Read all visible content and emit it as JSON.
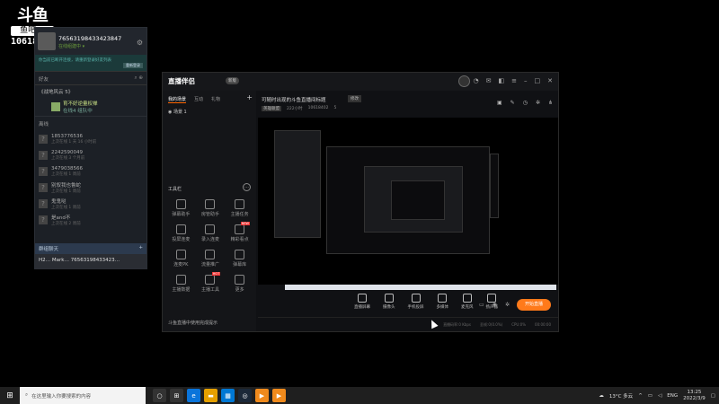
{
  "watermark": {
    "logo": "斗鱼",
    "sub": "鱼吧 ▷",
    "room_id": "10618402"
  },
  "friends": {
    "username": "76563198433423847",
    "status": "在线组建中 ▾",
    "notice": "你当前已断开连接，请重新登录好友列表",
    "notice_button": "重新登录",
    "bar_label": "好友",
    "group_label": "《战地风云 5》",
    "game_name": "育不好逆量权禅",
    "game_sub": "在线4 组队中",
    "section_label": "离线",
    "items": [
      {
        "name": "1853776536",
        "status": "上次在线 1 天 16 小时前"
      },
      {
        "name": "2242590049",
        "status": "上次在线 3 个月前"
      },
      {
        "name": "3479038566",
        "status": "上次在线 1 周前"
      },
      {
        "name": "别叙我也鲁蛇",
        "status": "上次在线 1 周前"
      },
      {
        "name": "鬼鬼哒",
        "status": "上次在线 1 周前"
      },
      {
        "name": "是and不",
        "status": "上次在线 2 周前"
      }
    ],
    "chatbar": "群组聊天",
    "chattab": "H2… Mark… 76563198433423…"
  },
  "app": {
    "brand": "直播伴侣",
    "version": "新版",
    "tabs": [
      "我的场景",
      "互动",
      "礼物"
    ],
    "scene": "场景 1",
    "tools_header": "工具栏",
    "tools": [
      {
        "label": "弹幕助手",
        "badge": ""
      },
      {
        "label": "房管助手",
        "badge": ""
      },
      {
        "label": "主播任务",
        "badge": ""
      },
      {
        "label": "投屏连麦",
        "badge": ""
      },
      {
        "label": "录入连麦",
        "badge": ""
      },
      {
        "label": "精彩看点",
        "badge": "NEW"
      },
      {
        "label": "连麦PK",
        "badge": ""
      },
      {
        "label": "流量推广",
        "badge": ""
      },
      {
        "label": "弹幕库",
        "badge": ""
      },
      {
        "label": "主播数据",
        "badge": ""
      },
      {
        "label": "主播工具",
        "badge": "HOT"
      },
      {
        "label": "更多",
        "badge": ""
      }
    ],
    "bottom_tip": "斗鱼直播中使用完成提示",
    "room_title": "可随时出现的斗鱼直播间标题",
    "room_badge": "修改",
    "room_category": "英雄联盟",
    "room_views": "222小时",
    "room_id": "10618402",
    "room_likes": "5",
    "controls": [
      "直播屏幕",
      "摄像头",
      "手机投屏",
      "多媒体",
      "麦克风",
      "扬声器"
    ],
    "go_live": "开始直播",
    "status": [
      "直播码率:0 Kbps",
      "丢帧:0(0.0%)",
      "CPU:0%",
      "00:00:00"
    ]
  },
  "taskbar": {
    "search_placeholder": "在这里输入你要搜索的内容",
    "weather": "13°C 多云",
    "lang": "ENG",
    "time": "13:25",
    "date": "2022/3/9"
  },
  "colors": {
    "accent": "#ff7a1a",
    "online": "#6ca03b"
  }
}
